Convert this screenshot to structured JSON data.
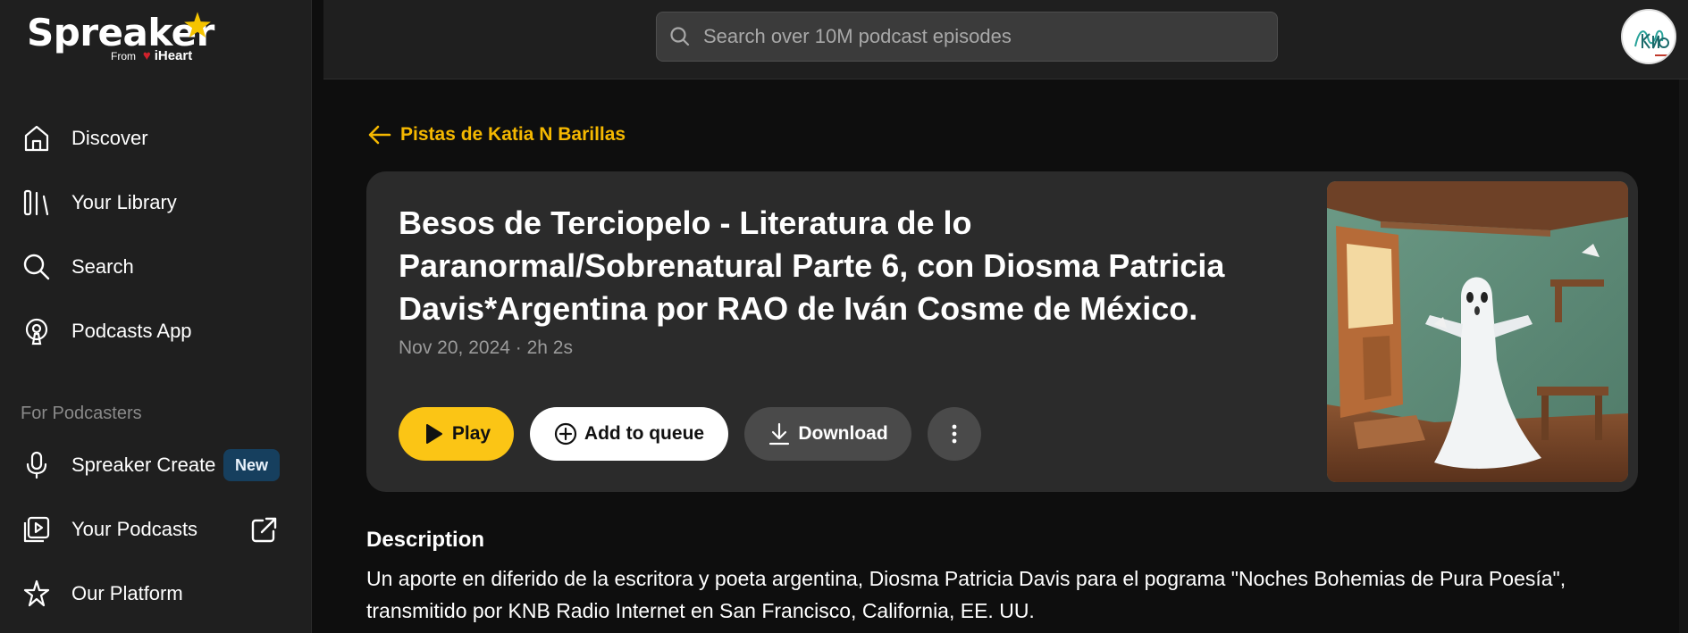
{
  "brand": {
    "name": "Spreaker",
    "from_label": "From",
    "parent": "iHeart"
  },
  "sidebar": {
    "items": [
      {
        "label": "Discover",
        "icon": "home-icon"
      },
      {
        "label": "Your Library",
        "icon": "library-icon"
      },
      {
        "label": "Search",
        "icon": "search-icon"
      },
      {
        "label": "Podcasts App",
        "icon": "podcast-app-icon"
      }
    ],
    "section_label": "For Podcasters",
    "podcaster_items": [
      {
        "label": "Spreaker Create",
        "icon": "microphone-icon",
        "badge": "New"
      },
      {
        "label": "Your Podcasts",
        "icon": "play-square-icon",
        "trailing_icon": "external-link-icon"
      },
      {
        "label": "Our Platform",
        "icon": "sparkle-icon"
      }
    ]
  },
  "search": {
    "placeholder": "Search over 10M podcast episodes"
  },
  "episode": {
    "back_label": "Pistas de Katia N Barillas",
    "title": "Besos de Terciopelo - Literatura de lo Paranormal/Sobrenatural Parte 6, con Diosma Patricia Davis*Argentina por RAO de Iván Cosme de México.",
    "meta": "Nov 20, 2024 · 2h 2s",
    "buttons": {
      "play": "Play",
      "queue": "Add to queue",
      "download": "Download"
    },
    "description_heading": "Description",
    "description": "Un aporte en diferido de la escritora y poeta argentina, Diosma Patricia Davis para el pograma \"Noches Bohemias de Pura Poesía\", transmitido por KNB Radio Internet en San Francisco, California, EE. UU."
  },
  "colors": {
    "accent": "#f5b800",
    "play_button": "#fbc515",
    "badge_bg": "#163f5e",
    "sidebar_bg": "#1f1f1f",
    "card_bg": "#2b2b2b"
  }
}
